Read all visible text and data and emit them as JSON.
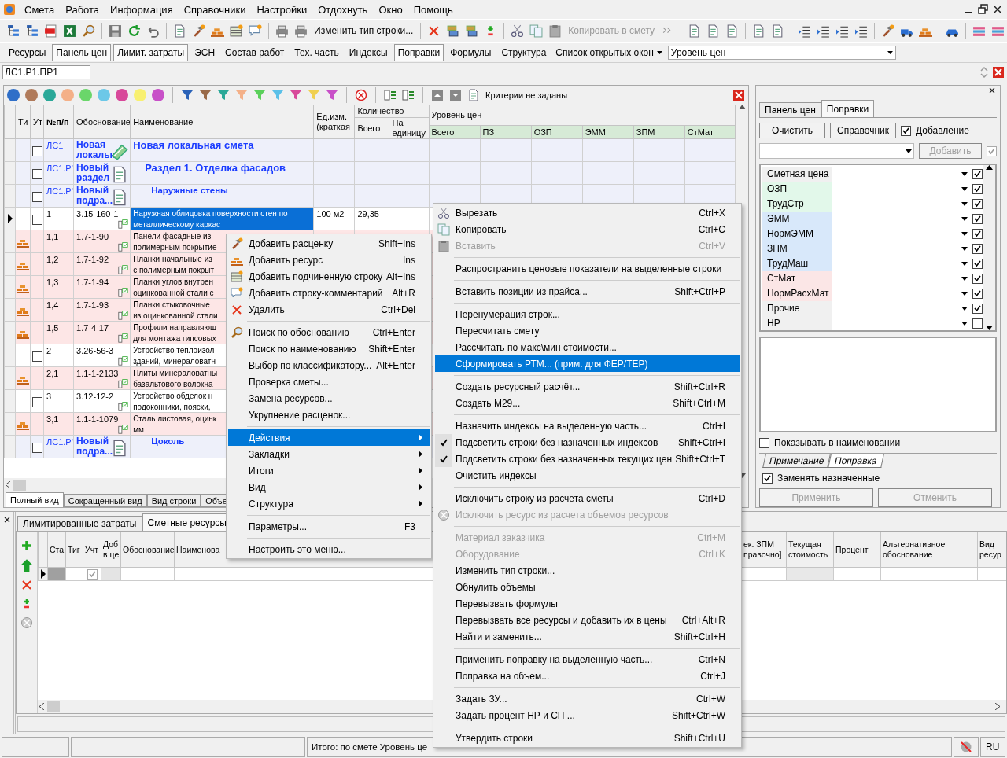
{
  "menu_bar": [
    "Смета",
    "Работа",
    "Информация",
    "Справочники",
    "Настройки",
    "Отдохнуть",
    "Окно",
    "Помощь"
  ],
  "toolbar": {
    "buttons": [
      {
        "label": "Изменить тип строки...",
        "disabled": false
      },
      {
        "label": "Копировать в смету",
        "disabled": true
      }
    ]
  },
  "panel_bar": {
    "buttons": [
      {
        "label": "Ресурсы",
        "on": false
      },
      {
        "label": "Панель цен",
        "on": true
      },
      {
        "label": "Лимит. затраты",
        "on": true
      },
      {
        "label": "ЭСН",
        "on": false
      },
      {
        "label": "Состав работ",
        "on": false
      },
      {
        "label": "Тех. часть",
        "on": false
      },
      {
        "label": "Индексы",
        "on": false
      },
      {
        "label": "Поправки",
        "on": true
      },
      {
        "label": "Формулы",
        "on": false
      },
      {
        "label": "Структура",
        "on": false
      }
    ],
    "windows_menu": "Список открытых окон",
    "price_level": "Уровень цен"
  },
  "address": "ЛС1.Р1.ПР1",
  "filter_bar": {
    "colors": [
      {
        "color": "#2f6fc8"
      },
      {
        "color": "#b07a5a"
      },
      {
        "color": "#2aa898"
      },
      {
        "color": "#f4b088"
      },
      {
        "color": "#6ad66a"
      },
      {
        "color": "#6cc8e8"
      },
      {
        "color": "#d8489a"
      },
      {
        "color": "#f8f070"
      },
      {
        "color": "#c850c8"
      }
    ],
    "funnels": [
      {
        "color": "#2a62b8"
      },
      {
        "color": "#9a6a48"
      },
      {
        "color": "#2aa898"
      },
      {
        "color": "#f4b088"
      },
      {
        "color": "#5ad05a"
      },
      {
        "color": "#5ac0e8"
      },
      {
        "color": "#d8489a"
      },
      {
        "color": "#f0d050"
      },
      {
        "color": "#c850c8"
      }
    ],
    "criteria": "Критерии не заданы"
  },
  "grid": {
    "headers": {
      "type": "Ти",
      "approved": "Ут",
      "number": "№п/п",
      "basis": "Обоснование",
      "name": "Наименование",
      "unit": "Ед.изм.\n(краткая",
      "quantity": "Количество",
      "quantity_total": "Всего",
      "quantity_unit": "На\nединицу",
      "price_level": "Уровень цен",
      "price_columns": [
        "Всего",
        "ПЗ",
        "ОЗП",
        "ЭММ",
        "ЗПМ",
        "СтМат"
      ]
    },
    "rows": [
      {
        "kind": "estimate",
        "approved": false,
        "number": "ЛС1",
        "basis": "Новая\nлокальн",
        "name": "Новая локальная смета",
        "selected": false
      },
      {
        "kind": "section",
        "approved": false,
        "number": "ЛС1.Р'",
        "basis": "Новый\nраздел",
        "name": "Раздел 1. Отделка фасадов",
        "selected": false
      },
      {
        "kind": "subsection",
        "approved": false,
        "number": "ЛС1.Р'",
        "basis": "Новый\nподра...",
        "name": "Наружные стены",
        "selected": false
      },
      {
        "kind": "position",
        "approved": false,
        "number": "1",
        "basis": "3.15-160-1",
        "name": "Наружная облицовка поверхности стен по\nметаллическому каркас",
        "unit": "100 м2",
        "quantity": "29,35",
        "selected": true
      },
      {
        "kind": "resource",
        "number": "1,1",
        "basis": "1.7-1-90",
        "name": "Панели фасадные из\nполимерным покрытие",
        "selected": false
      },
      {
        "kind": "resource",
        "number": "1,2",
        "basis": "1.7-1-92",
        "name": "Планки начальные из\nс полимерным покрыт",
        "selected": false
      },
      {
        "kind": "resource",
        "number": "1,3",
        "basis": "1.7-1-94",
        "name": "Планки углов внутрен\nоцинкованной стали с",
        "selected": false
      },
      {
        "kind": "resource",
        "number": "1,4",
        "basis": "1.7-1-93",
        "name": "Планки стыковочные\nиз оцинкованной стали",
        "selected": false
      },
      {
        "kind": "resource",
        "number": "1,5",
        "basis": "1.7-4-17",
        "name": "Профили направляющ\nдля монтажа гипсовых",
        "selected": false
      },
      {
        "kind": "position",
        "approved": false,
        "number": "2",
        "basis": "3.26-56-3",
        "name": "Устройство теплоизол\nзданий, минераловатн",
        "selected": false
      },
      {
        "kind": "resource",
        "number": "2,1",
        "basis": "1.1-1-2133",
        "name": "Плиты минераловатны\nбазальтового волокна",
        "selected": false
      },
      {
        "kind": "position",
        "approved": false,
        "number": "3",
        "basis": "3.12-12-2",
        "name": "Устройство обделок н\nподоконники, пояски,",
        "selected": false
      },
      {
        "kind": "resource",
        "number": "3,1",
        "basis": "1.1-1-1079",
        "name": "Сталь листовая, оцинк\nмм",
        "selected": false
      },
      {
        "kind": "subsection",
        "approved": false,
        "number": "ЛС1.Р'",
        "basis": "Новый\nподра...",
        "name": "Цоколь",
        "selected": false
      }
    ],
    "view_tabs": [
      {
        "label": "Полный вид",
        "selected": true
      },
      {
        "label": "Сокращенный вид",
        "selected": false
      },
      {
        "label": "Вид строки",
        "selected": false
      },
      {
        "label": "Объе",
        "selected": false
      }
    ]
  },
  "side_panel": {
    "tabs": [
      {
        "label": "Панель цен",
        "selected": false
      },
      {
        "label": "Поправки",
        "selected": true
      }
    ],
    "buttons": [
      "Очистить",
      "Справочник"
    ],
    "add_mode": {
      "label": "Добавление",
      "checked": true
    },
    "add_button": {
      "label": "Добавить",
      "disabled": true
    },
    "add_check": {
      "checked": true,
      "disabled": true
    },
    "adjustments": [
      {
        "name": "Сметная цена",
        "color": "#f0f0f0",
        "checked": true
      },
      {
        "name": "ОЗП",
        "color": "#e2f8ea",
        "checked": true
      },
      {
        "name": "ТрудСтр",
        "color": "#e2f8ea",
        "checked": true
      },
      {
        "name": "ЭММ",
        "color": "#d8e8fa",
        "checked": true
      },
      {
        "name": "НормЭММ",
        "color": "#d8e8fa",
        "checked": true
      },
      {
        "name": "ЗПМ",
        "color": "#d8e8fa",
        "checked": true
      },
      {
        "name": "ТрудМаш",
        "color": "#d8e8fa",
        "checked": true
      },
      {
        "name": "СтМат",
        "color": "#fbe6e6",
        "checked": true
      },
      {
        "name": "НормРасхМат",
        "color": "#fbe6e6",
        "checked": true
      },
      {
        "name": "Прочие",
        "color": "#f0f0f0",
        "checked": true
      },
      {
        "name": "НР",
        "color": "#f0f0f0",
        "checked": false
      }
    ],
    "show_in_name": {
      "label": "Показывать в наименовании",
      "checked": false
    },
    "bottom_tabs": [
      {
        "label": "Примечание",
        "selected": false
      },
      {
        "label": "Поправка",
        "selected": true
      }
    ],
    "replace": {
      "label": "Заменять назначенные",
      "checked": true
    },
    "actions": [
      {
        "label": "Применить",
        "disabled": true
      },
      {
        "label": "Отменить",
        "disabled": true
      }
    ]
  },
  "resources_panel": {
    "tabs": [
      {
        "label": "Лимитированные затраты",
        "selected": false
      },
      {
        "label": "Сметные ресурсы",
        "selected": true
      }
    ],
    "columns_left": [
      "Ста",
      "Тиг",
      "Учт",
      "Доб\nв це",
      "Обоснование",
      "Наименова"
    ],
    "columns_right": [
      "ек. ЗПМ\nправочно]",
      "Текущая\nстоимость",
      "Процент",
      "Альтернативное\nобоснование",
      "Вид\nресур"
    ],
    "rows": [
      {
        "included": true
      }
    ]
  },
  "status_bar": {
    "total": "Итого: по смете Уровень це",
    "language": "RU"
  },
  "context_menu": [
    {
      "kind": "item",
      "label": "Добавить расценку",
      "shortcut": "Shift+Ins",
      "selected": false,
      "submenu": false
    },
    {
      "kind": "item",
      "label": "Добавить ресурс",
      "shortcut": "Ins",
      "selected": false,
      "submenu": false
    },
    {
      "kind": "item",
      "label": "Добавить подчиненную строку",
      "shortcut": "Alt+Ins",
      "selected": false,
      "submenu": false
    },
    {
      "kind": "item",
      "label": "Добавить строку-комментарий",
      "shortcut": "Alt+R",
      "selected": false,
      "submenu": false
    },
    {
      "kind": "item",
      "label": "Удалить",
      "shortcut": "Ctrl+Del",
      "selected": false,
      "submenu": false
    },
    {
      "kind": "separator"
    },
    {
      "kind": "item",
      "label": "Поиск по обоснованию",
      "shortcut": "Ctrl+Enter",
      "selected": false,
      "submenu": false
    },
    {
      "kind": "item",
      "label": "Поиск по наименованию",
      "shortcut": "Shift+Enter",
      "selected": false,
      "submenu": false
    },
    {
      "kind": "item",
      "label": "Выбор по классификатору...",
      "shortcut": "Alt+Enter",
      "selected": false,
      "submenu": false
    },
    {
      "kind": "item",
      "label": "Проверка сметы...",
      "selected": false,
      "submenu": false
    },
    {
      "kind": "item",
      "label": "Замена ресурсов...",
      "selected": false,
      "submenu": false
    },
    {
      "kind": "item",
      "label": "Укрупнение расценок...",
      "selected": false,
      "submenu": false
    },
    {
      "kind": "separator"
    },
    {
      "kind": "item",
      "label": "Действия",
      "selected": true,
      "submenu": true
    },
    {
      "kind": "item",
      "label": "Закладки",
      "selected": false,
      "submenu": true
    },
    {
      "kind": "item",
      "label": "Итоги",
      "selected": false,
      "submenu": true
    },
    {
      "kind": "item",
      "label": "Вид",
      "selected": false,
      "submenu": true
    },
    {
      "kind": "item",
      "label": "Структура",
      "selected": false,
      "submenu": true
    },
    {
      "kind": "separator"
    },
    {
      "kind": "item",
      "label": "Параметры...",
      "shortcut": "F3",
      "selected": false,
      "submenu": false
    },
    {
      "kind": "separator"
    },
    {
      "kind": "item",
      "label": "Настроить это меню...",
      "selected": false,
      "submenu": false
    }
  ],
  "actions_submenu": [
    {
      "kind": "item",
      "label": "Вырезать",
      "shortcut": "Ctrl+X",
      "selected": false,
      "disabled": false,
      "checked": false
    },
    {
      "kind": "item",
      "label": "Копировать",
      "shortcut": "Ctrl+C",
      "selected": false,
      "disabled": false,
      "checked": false
    },
    {
      "kind": "item",
      "label": "Вставить",
      "shortcut": "Ctrl+V",
      "selected": false,
      "disabled": true,
      "checked": false
    },
    {
      "kind": "separator"
    },
    {
      "kind": "item",
      "label": "Распространить ценовые показатели на выделенные строки",
      "selected": false,
      "disabled": false,
      "checked": false
    },
    {
      "kind": "separator"
    },
    {
      "kind": "item",
      "label": "Вставить позиции из прайса...",
      "shortcut": "Shift+Ctrl+P",
      "selected": false,
      "disabled": false,
      "checked": false
    },
    {
      "kind": "separator"
    },
    {
      "kind": "item",
      "label": "Перенумерация строк...",
      "selected": false,
      "disabled": false,
      "checked": false
    },
    {
      "kind": "item",
      "label": "Пересчитать смету",
      "selected": false,
      "disabled": false,
      "checked": false
    },
    {
      "kind": "item",
      "label": "Рассчитать по макс\\мин стоимости...",
      "selected": false,
      "disabled": false,
      "checked": false
    },
    {
      "kind": "item",
      "label": "Сформировать РТМ...  (прим. для ФЕР/ТЕР)",
      "selected": true,
      "disabled": false,
      "checked": false
    },
    {
      "kind": "separator"
    },
    {
      "kind": "item",
      "label": "Создать ресурсный расчёт...",
      "shortcut": "Shift+Ctrl+R",
      "selected": false,
      "disabled": false,
      "checked": false
    },
    {
      "kind": "item",
      "label": "Создать М29...",
      "shortcut": "Shift+Ctrl+M",
      "selected": false,
      "disabled": false,
      "checked": false
    },
    {
      "kind": "separator"
    },
    {
      "kind": "item",
      "label": "Назначить индексы на выделенную часть...",
      "shortcut": "Ctrl+I",
      "selected": false,
      "disabled": false,
      "checked": false
    },
    {
      "kind": "item",
      "label": "Подсветить строки без назначенных индексов",
      "shortcut": "Shift+Ctrl+I",
      "selected": false,
      "disabled": false,
      "checked": true
    },
    {
      "kind": "item",
      "label": "Подсветить строки без назначенных текущих цен",
      "shortcut": "Shift+Ctrl+T",
      "selected": false,
      "disabled": false,
      "checked": true
    },
    {
      "kind": "item",
      "label": "Очистить индексы",
      "selected": false,
      "disabled": false,
      "checked": false
    },
    {
      "kind": "separator"
    },
    {
      "kind": "item",
      "label": "Исключить строку из расчета сметы",
      "shortcut": "Ctrl+D",
      "selected": false,
      "disabled": false,
      "checked": false
    },
    {
      "kind": "item",
      "label": "Исключить ресурс из расчета объемов ресурсов",
      "selected": false,
      "disabled": true,
      "checked": false
    },
    {
      "kind": "separator"
    },
    {
      "kind": "item",
      "label": "Материал заказчика",
      "shortcut": "Ctrl+M",
      "selected": false,
      "disabled": true,
      "checked": false
    },
    {
      "kind": "item",
      "label": "Оборудование",
      "shortcut": "Ctrl+K",
      "selected": false,
      "disabled": true,
      "checked": false
    },
    {
      "kind": "item",
      "label": "Изменить тип строки...",
      "selected": false,
      "disabled": false,
      "checked": false
    },
    {
      "kind": "item",
      "label": "Обнулить объемы",
      "selected": false,
      "disabled": false,
      "checked": false
    },
    {
      "kind": "item",
      "label": "Перевызвать формулы",
      "selected": false,
      "disabled": false,
      "checked": false
    },
    {
      "kind": "item",
      "label": "Перевызвать все ресурсы и добавить их в цены",
      "shortcut": "Ctrl+Alt+R",
      "selected": false,
      "disabled": false,
      "checked": false
    },
    {
      "kind": "item",
      "label": "Найти и заменить...",
      "shortcut": "Shift+Ctrl+H",
      "selected": false,
      "disabled": false,
      "checked": false
    },
    {
      "kind": "separator"
    },
    {
      "kind": "item",
      "label": "Применить поправку на выделенную часть...",
      "shortcut": "Ctrl+N",
      "selected": false,
      "disabled": false,
      "checked": false
    },
    {
      "kind": "item",
      "label": "Поправка на объем...",
      "shortcut": "Ctrl+J",
      "selected": false,
      "disabled": false,
      "checked": false
    },
    {
      "kind": "separator"
    },
    {
      "kind": "item",
      "label": "Задать ЗУ...",
      "shortcut": "Ctrl+W",
      "selected": false,
      "disabled": false,
      "checked": false
    },
    {
      "kind": "item",
      "label": "Задать процент НР и СП ...",
      "shortcut": "Shift+Ctrl+W",
      "selected": false,
      "disabled": false,
      "checked": false
    },
    {
      "kind": "separator"
    },
    {
      "kind": "item",
      "label": "Утвердить строки",
      "shortcut": "Shift+Ctrl+U",
      "selected": false,
      "disabled": false,
      "checked": false
    }
  ]
}
